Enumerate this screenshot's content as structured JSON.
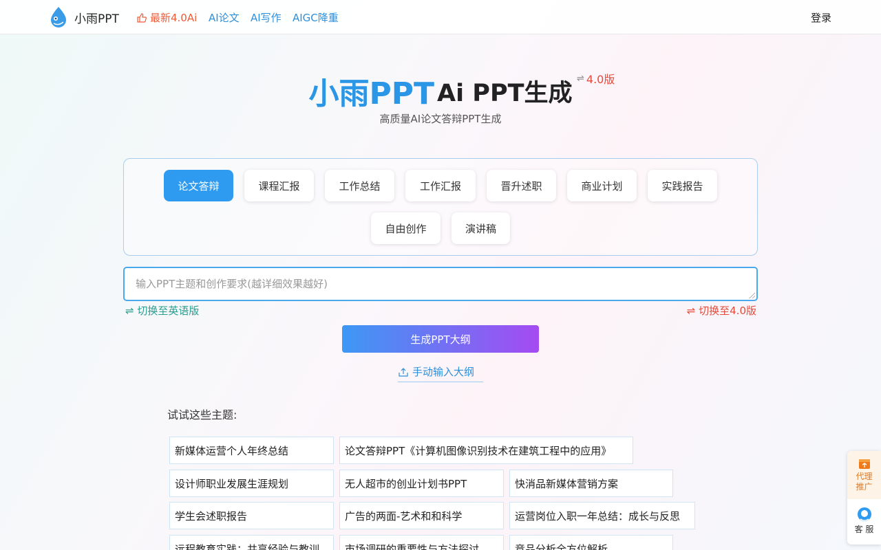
{
  "header": {
    "brand": "小雨PPT",
    "nav": [
      {
        "label": "最新4.0Ai"
      },
      {
        "label": "AI论文"
      },
      {
        "label": "AI写作"
      },
      {
        "label": "AIGC降重"
      }
    ],
    "login": "登录"
  },
  "hero": {
    "title_brand": "小雨PPT",
    "title_main": "Ai PPT生成",
    "version_label": "4.0版",
    "subtitle": "高质量AI论文答辩PPT生成"
  },
  "categories": [
    {
      "label": "论文答辩",
      "active": true
    },
    {
      "label": "课程汇报"
    },
    {
      "label": "工作总结"
    },
    {
      "label": "工作汇报"
    },
    {
      "label": "晋升述职"
    },
    {
      "label": "商业计划"
    },
    {
      "label": "实践报告"
    },
    {
      "label": "自由创作"
    },
    {
      "label": "演讲稿"
    }
  ],
  "prompt": {
    "placeholder": "输入PPT主题和创作要求(越详细效果越好)",
    "value": ""
  },
  "switches": {
    "english": "⇌ 切换至英语版",
    "v40": "⇌ 切换至4.0版"
  },
  "generate_button": "生成PPT大纲",
  "manual_outline": "手动输入大纲",
  "suggestions": {
    "label": "试试这些主题:",
    "items": [
      "新媒体运营个人年终总结",
      "论文答辩PPT《计算机图像识别技术在建筑工程中的应用》",
      "设计师职业发展生涯规划",
      "无人超市的创业计划书PPT",
      "快消品新媒体营销方案",
      "学生会述职报告",
      "广告的两面-艺术和和科学",
      "运营岗位入职一年总结：成长与反思",
      "远程教育实践：共享经验与教训",
      "市场调研的重要性与方法探讨",
      "竞品分析全方位解析"
    ]
  },
  "float": {
    "agent": "代理推广",
    "agent_line1": "代理",
    "agent_line2": "推广",
    "service": "客 服"
  },
  "colors": {
    "brand_blue": "#2b95e6",
    "active_tab": "#2f9bf0",
    "accent_red": "#e54a3a",
    "accent_orange": "#f15a35",
    "accent_teal": "#2a9d8f",
    "gradient_start": "#3d98f5",
    "gradient_end": "#a54bf2"
  }
}
